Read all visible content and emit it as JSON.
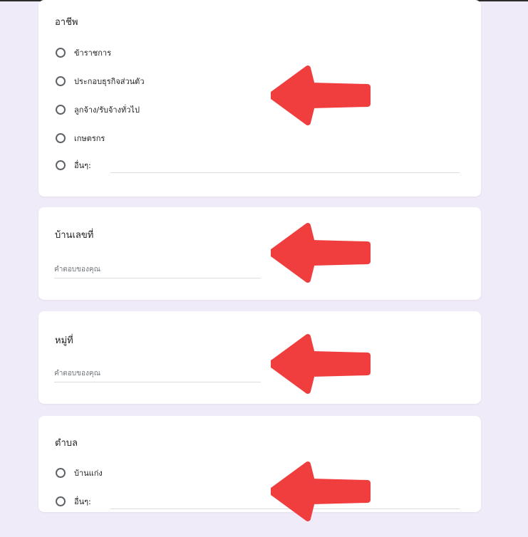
{
  "questions": {
    "occupation": {
      "title": "อาชีพ",
      "options": [
        "ข้าราชการ",
        "ประกอบธุรกิจส่วนตัว",
        "ลูกจ้าง/รับจ้างทั่วไป",
        "เกษตรกร",
        "อื่นๆ:"
      ]
    },
    "house_number": {
      "title": "บ้านเลขที่",
      "placeholder": "คำตอบของคุณ"
    },
    "village_no": {
      "title": "หมู่ที่",
      "placeholder": "คำตอบของคุณ"
    },
    "subdistrict": {
      "title": "ตำบล",
      "options": [
        "บ้านแก่ง",
        "อื่นๆ:"
      ]
    }
  },
  "colors": {
    "page_bg": "#f0ebf8",
    "card_bg": "#ffffff",
    "arrow": "#f03d3d"
  },
  "icons": {
    "arrow": "left-arrow-icon",
    "radio": "radio-button-icon"
  }
}
